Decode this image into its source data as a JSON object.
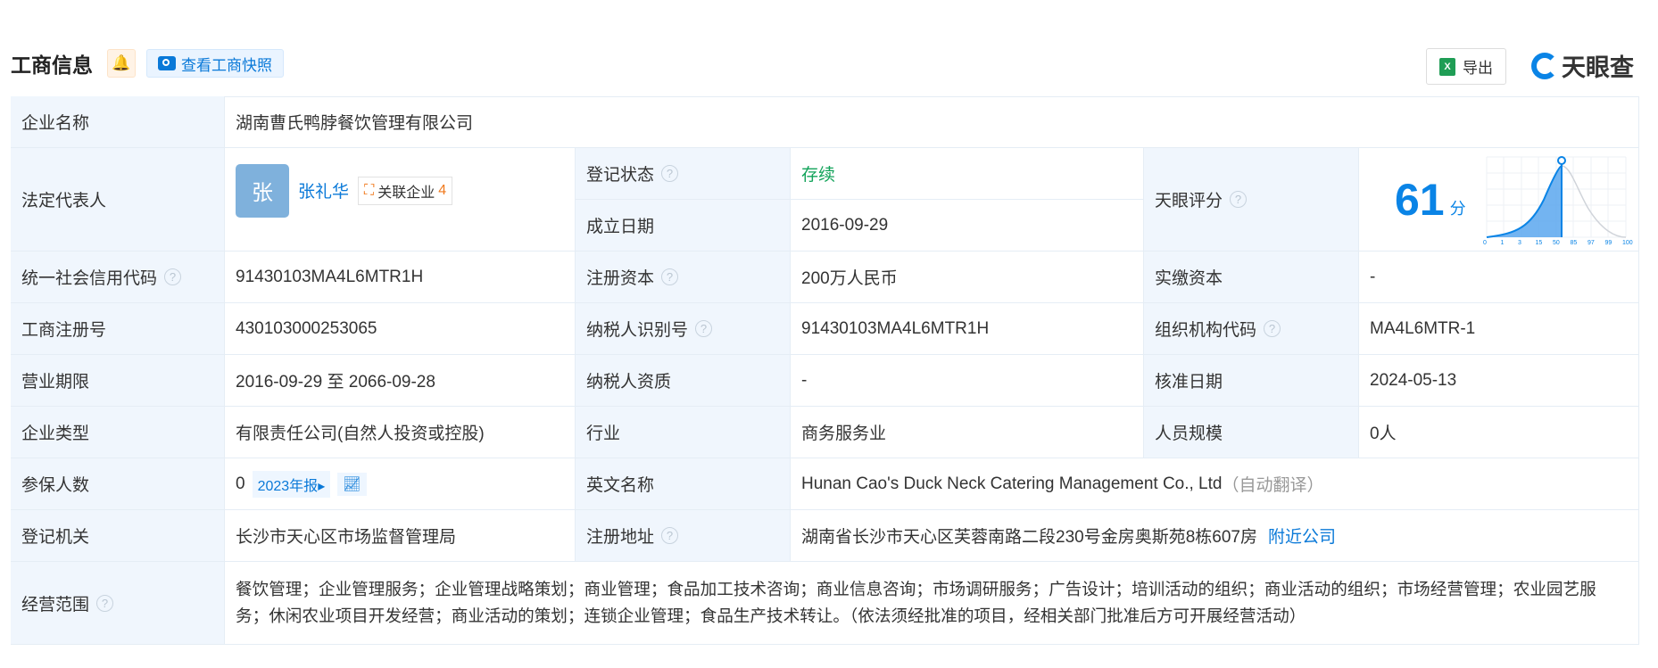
{
  "header": {
    "title": "工商信息",
    "snapshot_label": "查看工商快照",
    "export_label": "导出",
    "logo_text": "天眼查"
  },
  "rows": {
    "company_name": {
      "label": "企业名称",
      "value": "湖南曹氏鸭脖餐饮管理有限公司"
    },
    "legal_rep": {
      "label": "法定代表人",
      "avatar": "张",
      "name": "张礼华",
      "related_label": "关联企业",
      "related_count": "4"
    },
    "reg_status": {
      "label": "登记状态",
      "value": "存续"
    },
    "founded": {
      "label": "成立日期",
      "value": "2016-09-29"
    },
    "score": {
      "label": "天眼评分",
      "value": "61",
      "unit": "分",
      "axis": [
        "0",
        "1",
        "3",
        "15",
        "50",
        "85",
        "97",
        "99",
        "100"
      ]
    },
    "credit_code": {
      "label": "统一社会信用代码",
      "value": "91430103MA4L6MTR1H"
    },
    "reg_capital": {
      "label": "注册资本",
      "value": "200万人民币"
    },
    "paid_capital": {
      "label": "实缴资本",
      "value": "-"
    },
    "reg_no": {
      "label": "工商注册号",
      "value": "430103000253065"
    },
    "taxpayer_id": {
      "label": "纳税人识别号",
      "value": "91430103MA4L6MTR1H"
    },
    "org_code": {
      "label": "组织机构代码",
      "value": "MA4L6MTR-1"
    },
    "term": {
      "label": "营业期限",
      "value": "2016-09-29 至 2066-09-28"
    },
    "taxpayer_qual": {
      "label": "纳税人资质",
      "value": "-"
    },
    "approval_date": {
      "label": "核准日期",
      "value": "2024-05-13"
    },
    "company_type": {
      "label": "企业类型",
      "value": "有限责任公司(自然人投资或控股)"
    },
    "industry": {
      "label": "行业",
      "value": "商务服务业"
    },
    "staff_size": {
      "label": "人员规模",
      "value": "0人"
    },
    "insured": {
      "label": "参保人数",
      "value": "0",
      "report": "2023年报"
    },
    "english_name": {
      "label": "英文名称",
      "value": "Hunan Cao's Duck Neck Catering Management Co., Ltd",
      "note": "（自动翻译）"
    },
    "authority": {
      "label": "登记机关",
      "value": "长沙市天心区市场监督管理局"
    },
    "address": {
      "label": "注册地址",
      "value": "湖南省长沙市天心区芙蓉南路二段230号金房奥斯苑8栋607房",
      "nearby": "附近公司"
    },
    "scope": {
      "label": "经营范围",
      "value": "餐饮管理；企业管理服务；企业管理战略策划；商业管理；食品加工技术咨询；商业信息咨询；市场调研服务；广告设计；培训活动的组织；商业活动的组织；市场经营管理；农业园艺服务；休闲农业项目开发经营；商业活动的策划；连锁企业管理；食品生产技术转让。（依法须经批准的项目，经相关部门批准后方可开展经营活动）"
    }
  }
}
